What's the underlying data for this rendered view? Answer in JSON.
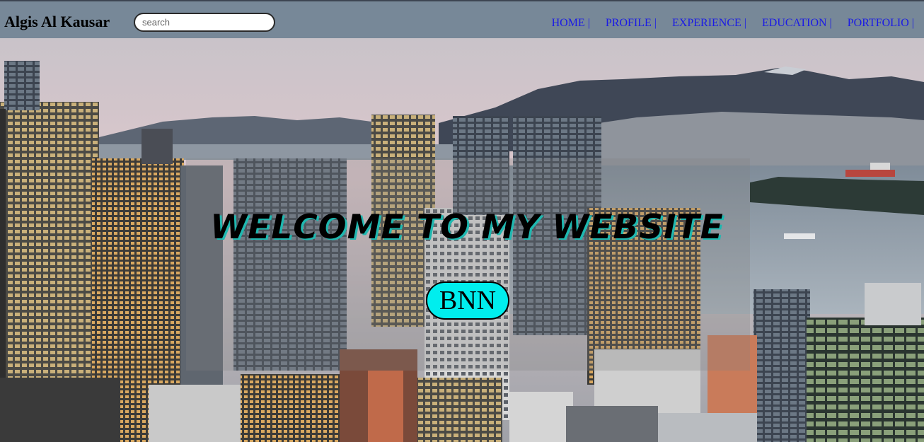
{
  "header": {
    "brand": "Algis Al Kausar",
    "search_placeholder": "search",
    "nav": [
      {
        "label": "HOME |"
      },
      {
        "label": "PROFILE |"
      },
      {
        "label": "EXPERIENCE |"
      },
      {
        "label": "EDUCATION |"
      },
      {
        "label": "PORTFOLIO |"
      }
    ]
  },
  "hero": {
    "title": "WELCOME TO MY WEBSITE",
    "button_label": "BNN"
  },
  "colors": {
    "header_bg": "#778898",
    "nav_link": "#1a1ae6",
    "button_bg": "#00eeee",
    "title_shadow": "#1fb8b0"
  }
}
